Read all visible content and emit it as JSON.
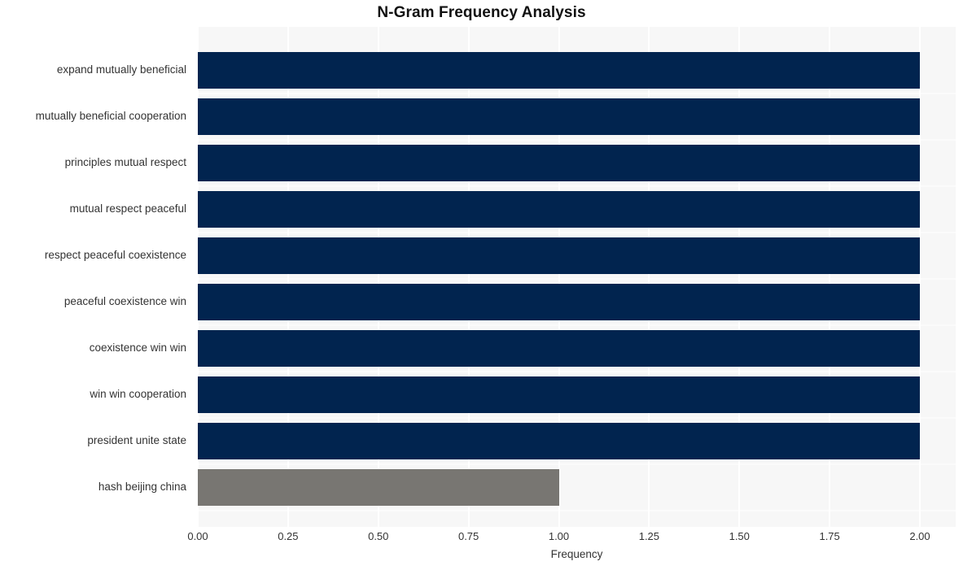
{
  "chart_data": {
    "type": "bar",
    "orientation": "horizontal",
    "title": "N-Gram Frequency Analysis",
    "xlabel": "Frequency",
    "ylabel": "",
    "xlim": [
      0,
      2.1
    ],
    "xticks": [
      "0.00",
      "0.25",
      "0.50",
      "0.75",
      "1.00",
      "1.25",
      "1.50",
      "1.75",
      "2.00"
    ],
    "xtick_values": [
      0,
      0.25,
      0.5,
      0.75,
      1.0,
      1.25,
      1.5,
      1.75,
      2.0
    ],
    "grid": true,
    "legend": null,
    "categories": [
      "expand mutually beneficial",
      "mutually beneficial cooperation",
      "principles mutual respect",
      "mutual respect peaceful",
      "respect peaceful coexistence",
      "peaceful coexistence win",
      "coexistence win win",
      "win win cooperation",
      "president unite state",
      "hash beijing china"
    ],
    "values": [
      2,
      2,
      2,
      2,
      2,
      2,
      2,
      2,
      2,
      1
    ],
    "bar_colors": [
      "#01244f",
      "#01244f",
      "#01244f",
      "#01244f",
      "#01244f",
      "#01244f",
      "#01244f",
      "#01244f",
      "#01244f",
      "#787672"
    ],
    "plot_background": "#f7f7f7",
    "gridline_color": "#ffffff",
    "figure_background": "#ffffff",
    "title_color": "#111111",
    "tick_label_color": "#333333"
  }
}
